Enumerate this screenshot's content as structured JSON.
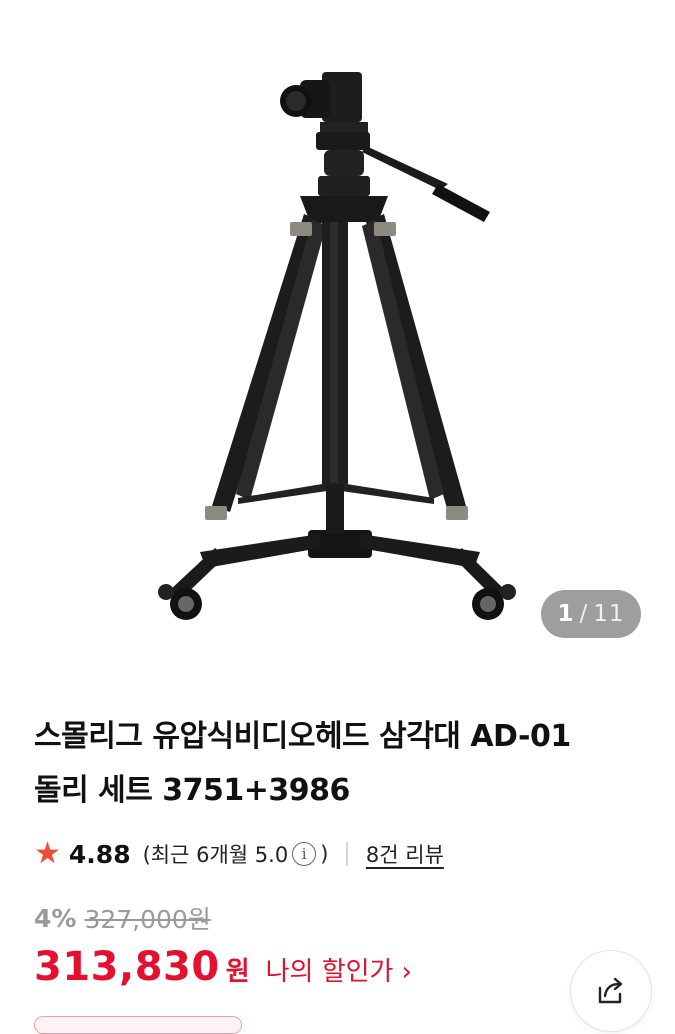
{
  "product": {
    "title_line1": "스몰리그 유압식비디오헤드 삼각대 AD-01",
    "title_line2": "돌리 세트 3751+3986",
    "image_subject": "tripod with video head, camera and dolly wheels"
  },
  "gallery": {
    "current": "1",
    "separator": "/",
    "total": "11"
  },
  "rating": {
    "star_icon": "★",
    "score": "4.88",
    "recent_prefix": "(최근 6개월 5.0",
    "info_icon": "i",
    "recent_suffix": ")",
    "reviews_link": "8건 리뷰"
  },
  "price": {
    "discount_percent": "4%",
    "original": "327,000원",
    "current": "313,830",
    "currency": "원",
    "my_discount_link": "나의 할인가",
    "chevron": "›"
  },
  "colors": {
    "accent_red": "#e3102f",
    "star_red": "#f24a3a",
    "muted_gray": "#9a9a9a",
    "counter_bg": "#9e9e9e"
  },
  "icons": {
    "share": "share-icon"
  }
}
